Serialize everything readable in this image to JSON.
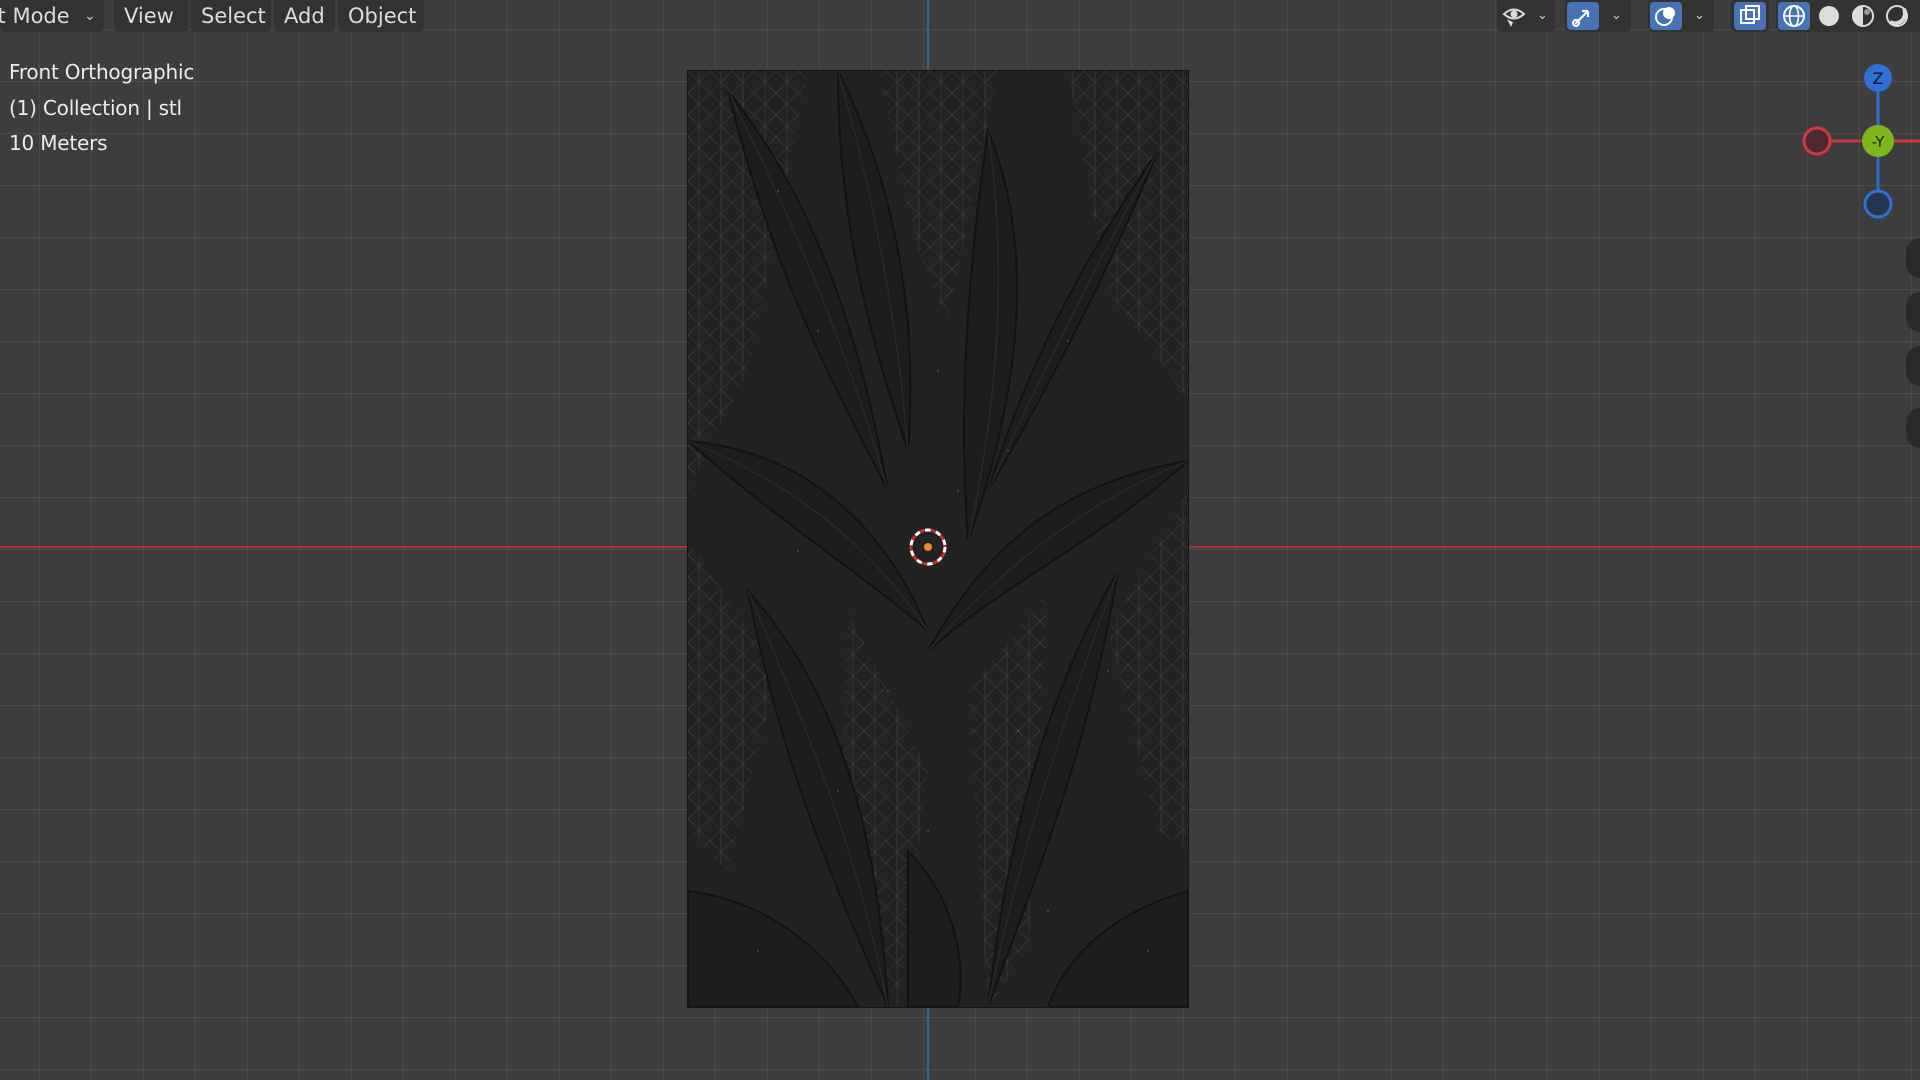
{
  "header": {
    "mode_label": "ct Mode",
    "menu": {
      "view": "View",
      "select": "Select",
      "add": "Add",
      "object": "Object"
    }
  },
  "overlay": {
    "view_name": "Front Orthographic",
    "collection": "(1) Collection | stl",
    "scale": "10 Meters"
  },
  "gizmo": {
    "z_label": "Z",
    "y_label": "-Y"
  },
  "colors": {
    "background": "#3d3d3d",
    "x_axis": "#a8303a",
    "z_axis": "#2f64a8",
    "gizmo_x": "#d2383f",
    "gizmo_y": "#7fb51d",
    "gizmo_z": "#2f6fd6",
    "active": "#4772b3"
  },
  "icons": [
    "visibility-eye-icon",
    "gizmo-toggle-icon",
    "overlays-icon",
    "xray-toggle-icon",
    "wireframe-shading-icon",
    "solid-shading-icon",
    "material-preview-icon",
    "rendered-shading-icon"
  ]
}
